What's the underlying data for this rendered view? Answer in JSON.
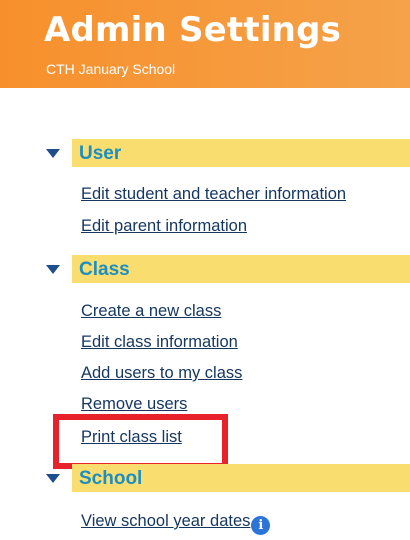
{
  "header": {
    "title": "Admin Settings",
    "subtitle": "CTH January School"
  },
  "sections": {
    "user": {
      "title": "User",
      "links": [
        "Edit student and teacher information",
        "Edit parent information"
      ]
    },
    "class": {
      "title": "Class",
      "links": [
        "Create a new class",
        "Edit class information",
        "Add users to my class",
        "Remove users",
        "Print class list"
      ]
    },
    "school": {
      "title": "School",
      "links": [
        "View school year dates"
      ]
    }
  },
  "icons": {
    "section_toggle": "triangle-down-icon",
    "info": "info-icon",
    "info_glyph": "i"
  },
  "colors": {
    "header_bg": "#f7902c",
    "section_bar": "#f9de6f",
    "section_title": "#1c8ec2",
    "link": "#14365f",
    "toggle": "#1e4f8c",
    "info_icon": "#2d74d8",
    "highlight": "#e8222b"
  }
}
